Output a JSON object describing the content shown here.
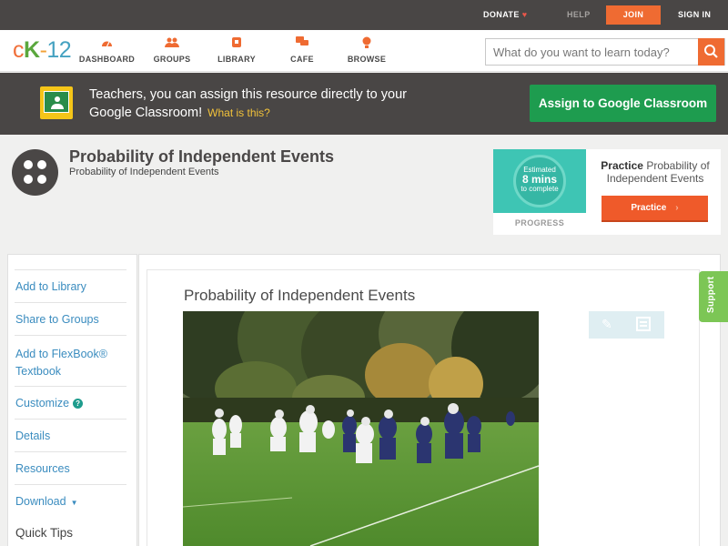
{
  "topbar": {
    "donate": "DONATE",
    "help": "HELP",
    "join": "JOIN",
    "signin": "SIGN IN"
  },
  "logo": {
    "c": "c",
    "k": "K",
    "dash": "-",
    "num": "12"
  },
  "nav": {
    "items": [
      {
        "label": "DASHBOARD",
        "icon": "dashboard-icon"
      },
      {
        "label": "GROUPS",
        "icon": "groups-icon"
      },
      {
        "label": "LIBRARY",
        "icon": "library-icon"
      },
      {
        "label": "CAFE",
        "icon": "cafe-icon"
      },
      {
        "label": "BROWSE",
        "icon": "browse-icon"
      }
    ],
    "search_placeholder": "What do you want to learn today?"
  },
  "banner": {
    "text": "Teachers, you can assign this resource directly to your Google Classroom!",
    "what_is_this": "What is this?",
    "assign_button": "Assign to Google Classroom"
  },
  "concept": {
    "title": "Probability of Independent Events",
    "subtitle": "Probability of Independent Events"
  },
  "practice": {
    "estimated": "Estimated",
    "mins": "8 mins",
    "to_complete": "to complete",
    "progress_label": "PROGRESS",
    "heading_bold": "Practice",
    "heading_rest": "Probability of Independent Events",
    "button": "Practice"
  },
  "sidebar": {
    "items": [
      {
        "label": "Add to Library"
      },
      {
        "label": "Share to Groups"
      },
      {
        "label": "Add to FlexBook® Textbook"
      },
      {
        "label": "Customize"
      },
      {
        "label": "Details"
      },
      {
        "label": "Resources"
      },
      {
        "label": "Download"
      }
    ],
    "quick_tips": "Quick Tips"
  },
  "content": {
    "title": "Probability of Independent Events",
    "image_alt": "Football players on a field"
  },
  "support": "Support",
  "colors": {
    "accent": "#ef6b32",
    "dark_bar": "#494645",
    "google_green": "#1e9c4f",
    "link_blue": "#3a8cbf",
    "support_green": "#7cc655"
  }
}
